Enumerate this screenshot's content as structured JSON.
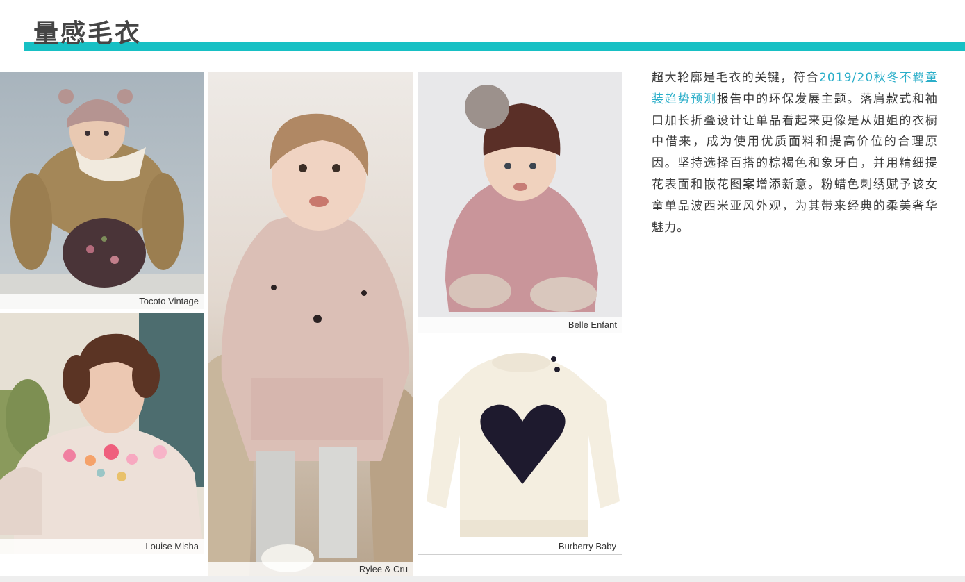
{
  "page": {
    "title": "量感毛衣"
  },
  "colors": {
    "accent": "#17c0c4",
    "link": "#2aaec9",
    "title_text": "#454545",
    "body_text": "#3a3a3a"
  },
  "photos": [
    {
      "subject": "baby in brown knit sweater, bear-ear beanie and floral romper",
      "caption": "Tocoto Vintage"
    },
    {
      "subject": "toddler in cream sweater with embroidered pink flowers",
      "caption": "Louise Misha"
    },
    {
      "subject": "toddler in long pink chenille sweater with knee socks",
      "caption": "Rylee & Cru"
    },
    {
      "subject": "baby in pink knit sweater and brown pom-pom beanie",
      "caption": "Belle Enfant"
    },
    {
      "subject": "cream sweater with black heart intarsia",
      "caption": "Burberry Baby"
    }
  ],
  "body": {
    "before_link": "超大轮廓是毛衣的关键，符合",
    "link_text": "2019/20秋冬不羁童装趋势预测",
    "after_link": "报告中的环保发展主题。落肩款式和袖口加长折叠设计让单品看起来更像是从姐姐的衣橱中借来，成为使用优质面料和提高价位的合理原因。坚持选择百搭的棕褐色和象牙白，并用精细提花表面和嵌花图案增添新意。粉蜡色刺绣赋予该女童单品波西米亚风外观，为其带来经典的柔美奢华魅力。"
  }
}
